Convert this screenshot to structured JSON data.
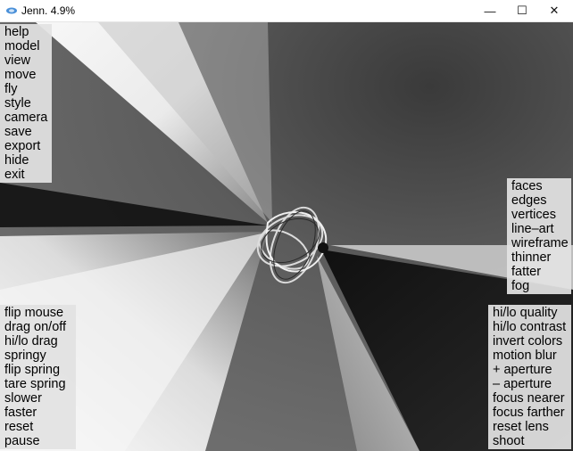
{
  "window": {
    "title": "Jenn. 4.9%"
  },
  "controls": {
    "minimize": "—",
    "maximize": "☐",
    "close": "✕"
  },
  "menus": {
    "top_left": [
      "help",
      "model",
      "view",
      "move",
      "fly",
      "style",
      "camera",
      "save",
      "export",
      "hide",
      "exit"
    ],
    "right_mid": [
      "faces",
      "edges",
      "vertices",
      "line–art",
      "wireframe",
      "thinner",
      "fatter",
      "fog"
    ],
    "bottom_left": [
      "flip mouse",
      "drag on/off",
      "hi/lo drag",
      "springy",
      "flip spring",
      "tare spring",
      "slower",
      "faster",
      "reset",
      "pause"
    ],
    "bottom_right": [
      "hi/lo quality",
      "hi/lo contrast",
      "invert colors",
      "motion blur",
      "+ aperture",
      "– aperture",
      "focus nearer",
      "focus farther",
      "reset lens",
      "shoot"
    ]
  },
  "icons": {
    "app": "jenn-app-icon"
  }
}
